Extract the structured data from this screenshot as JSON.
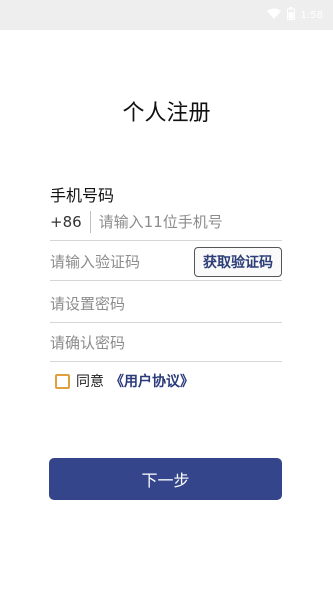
{
  "status_bar": {
    "wifi_icon": "wifi-icon",
    "battery_icon": "battery-icon",
    "time": "1:58"
  },
  "page": {
    "title": "个人注册"
  },
  "form": {
    "phone_label": "手机号码",
    "country_code": "+86",
    "phone_placeholder": "请输入11位手机号",
    "code_placeholder": "请输入验证码",
    "get_code_label": "获取验证码",
    "password_placeholder": "请设置密码",
    "confirm_password_placeholder": "请确认密码",
    "agree_text": "同意",
    "agreement_link": "《用户协议》",
    "next_label": "下一步"
  },
  "colors": {
    "primary": "#34458c",
    "checkbox_border": "#e0a040"
  }
}
